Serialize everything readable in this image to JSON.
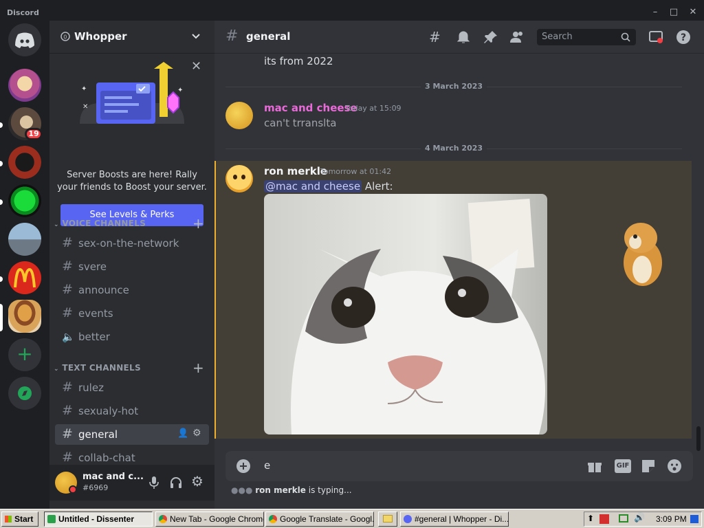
{
  "window": {
    "title": "Discord"
  },
  "servers": {
    "mention_badge": "19"
  },
  "guild": {
    "name": "Whopper"
  },
  "boost": {
    "text": "Server Boosts are here! Rally your friends to Boost your server.",
    "button": "See Levels & Perks"
  },
  "categories": {
    "voice": "VOICE CHANNELS",
    "text": "TEXT CHANNELS"
  },
  "voice_channels": [
    {
      "name": "sex-on-the-network"
    },
    {
      "name": "svere"
    },
    {
      "name": "announce"
    },
    {
      "name": "events"
    },
    {
      "name": "better"
    }
  ],
  "text_channels": [
    {
      "name": "rulez"
    },
    {
      "name": "sexualy-hot"
    },
    {
      "name": "general"
    },
    {
      "name": "collab-chat"
    }
  ],
  "user": {
    "name": "mac and c...",
    "tag": "#6969"
  },
  "channel": {
    "name": "general",
    "search_placeholder": "Search"
  },
  "messages": {
    "top_text": "its from 2022",
    "date1": "3 March 2023",
    "m1": {
      "author": "mac and cheese",
      "time": "Today at 15:09",
      "text": "can't trranslta"
    },
    "date2": "4 March 2023",
    "m2": {
      "author": "ron merkle",
      "time": "Tomorrow at 01:42",
      "mention": "@mac and cheese",
      "text": "Alert:"
    }
  },
  "composer": {
    "value": "e"
  },
  "typing": {
    "user": "ron merkle",
    "text": "is typing..."
  },
  "taskbar": {
    "start": "Start",
    "buttons": [
      "Untitled - Dissenter",
      "New Tab - Google Chrome",
      "Google Translate - Googl...",
      "#general | Whopper - Di..."
    ],
    "clock": "3:09 PM"
  },
  "colors": {
    "accent": "#5865f2",
    "author1": "#e96ad8",
    "mention_bar": "#f0b132",
    "online": "#23a559"
  }
}
